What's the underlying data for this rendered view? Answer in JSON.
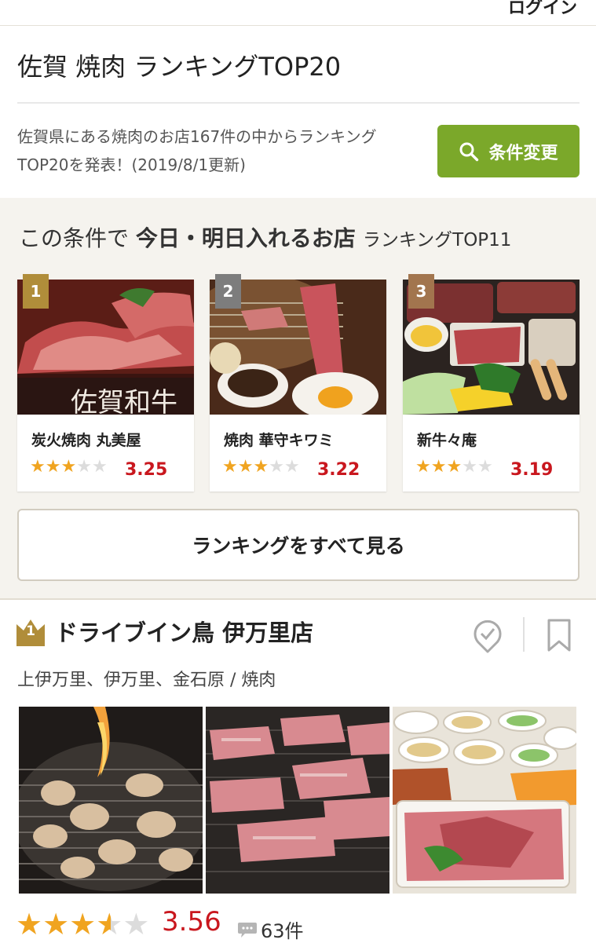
{
  "header": {
    "login": "ログイン"
  },
  "page": {
    "title": "佐賀 焼肉 ランキングTOP20",
    "description": "佐賀県にある焼肉のお店167件の中からランキングTOP20を発表！(2019/8/1更新)",
    "search_button": "条件変更"
  },
  "today": {
    "heading_prefix": "この条件で",
    "heading_bold": "今日・明日入れるお店",
    "heading_suffix": "ランキングTOP11",
    "cards": [
      {
        "rank": "1",
        "name": "炭火焼肉 丸美屋",
        "stars": 3,
        "score": "3.25",
        "badge_color": "#b08d3a",
        "photo_caption": "佐賀和牛"
      },
      {
        "rank": "2",
        "name": "焼肉 華守キワミ",
        "stars": 3,
        "score": "3.22",
        "badge_color": "#7d7d7d"
      },
      {
        "rank": "3",
        "name": "新牛々庵",
        "stars": 3,
        "score": "3.19",
        "badge_color": "#a2754e"
      }
    ],
    "all_button": "ランキングをすべて見る"
  },
  "shop": {
    "rank": "1",
    "name": "ドライブイン鳥 伊万里店",
    "area": "上伊万里、伊万里、金石原 / 焼肉",
    "rating": 3.56,
    "score": "3.56",
    "reviews": "63件"
  },
  "colors": {
    "accent_green": "#7ba82a",
    "score_red": "#c9171e",
    "star_orange": "#f0a420",
    "gold": "#b08d3a"
  },
  "icons": {
    "search": "search-icon",
    "pin": "check-pin-icon",
    "bookmark": "bookmark-icon",
    "comment": "comment-icon",
    "crown": "crown-icon"
  }
}
